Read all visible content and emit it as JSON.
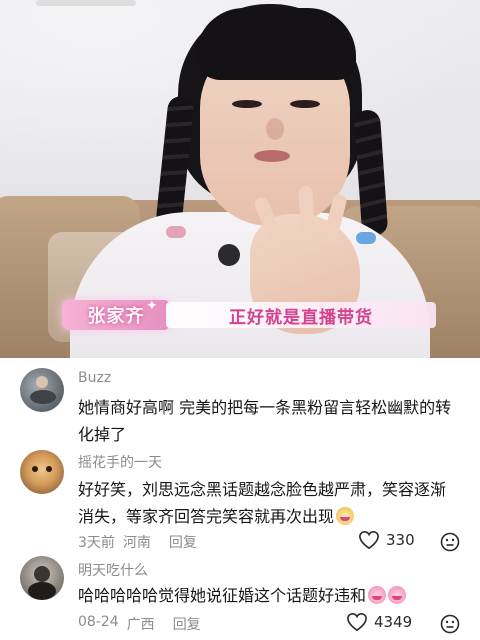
{
  "video": {
    "name_tag": "张家齐",
    "caption": "正好就是直播带货"
  },
  "comments": [
    {
      "username": "Buzz",
      "content": "她情商好高啊 完美的把每一条黑粉留言轻松幽默的转化掉了"
    },
    {
      "username": "摇花手的一天",
      "content": "好好笑，刘思远念黑话题越念脸色越严肃，笑容逐渐消失，等家齐回答完笑容就再次出现",
      "emoji": "cat-laughing-emoji",
      "time": "3天前",
      "location": "河南",
      "reply_label": "回复",
      "likes": "330"
    },
    {
      "username": "明天吃什么",
      "content": "哈哈哈哈哈觉得她说征婚这个话题好违和",
      "emoji": "crying-laughing-emoji",
      "time": "08-24",
      "location": "广西",
      "reply_label": "回复",
      "likes": "4349"
    }
  ],
  "icons": {
    "like": "heart-outline-icon",
    "dislike": "meh-face-icon"
  },
  "colors": {
    "caption_text": "#d2438f",
    "name_tag": "#e58fc0",
    "meta_text": "#8c8c8c"
  }
}
